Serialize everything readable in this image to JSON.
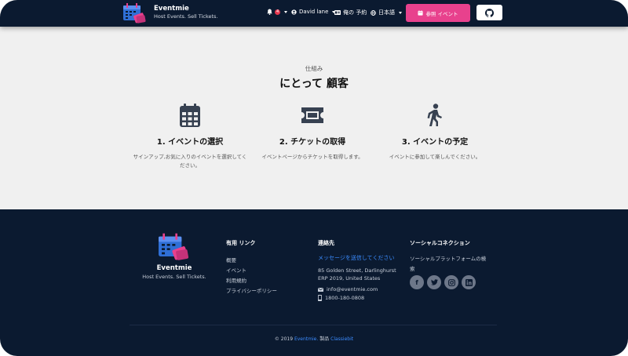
{
  "navbar": {
    "brand_name": "Eventmie",
    "brand_tagline": "Host Events. Sell Tickets.",
    "notification_count": "4",
    "user_name": "David lane",
    "my_bookings": "俺の 予約",
    "language": "日本語",
    "join_button": "参照 イベント"
  },
  "how_it_works": {
    "subtitle": "仕組み",
    "title": "にとって 顧客",
    "steps": [
      {
        "title": "1. イベントの選択",
        "desc": "サインアップ,お気に入りのイベントを選択してください。",
        "icon": "calendar-icon"
      },
      {
        "title": "2. チケットの取得",
        "desc": "イベントページからチケットを取得します。",
        "icon": "ticket-icon"
      },
      {
        "title": "3. イベントの予定",
        "desc": "イベントに参加して楽しんでください。",
        "icon": "walking-icon"
      }
    ]
  },
  "footer": {
    "brand_name": "Eventmie",
    "brand_tagline": "Host Events. Sell Tickets.",
    "links_heading": "有用 リンク",
    "links": [
      "概要",
      "イベント",
      "利用規約",
      "プライバシーポリシー"
    ],
    "contact_heading": "連絡先",
    "contact_link": "メッセージを送信してください",
    "address_line1": "85 Golden Street, Darlinghurst",
    "address_line2": "ERP 2019, United States",
    "email": "info@eventmie.com",
    "phone": "1800-180-0808",
    "social_heading": "ソーシャルコネクション",
    "social_text": "ソーシャルプラットフォームの検索",
    "social_icons": [
      "facebook-icon",
      "twitter-icon",
      "instagram-icon",
      "linkedin-icon"
    ],
    "copyright_prefix": "© 2019",
    "copyright_brand": "Eventmie.",
    "copyright_mid": "製品",
    "copyright_company": "Classiebit"
  },
  "colors": {
    "navy": "#0b1a30",
    "pink": "#e8418d",
    "link_blue": "#3b8cff",
    "section_bg": "#f0f0f0"
  }
}
